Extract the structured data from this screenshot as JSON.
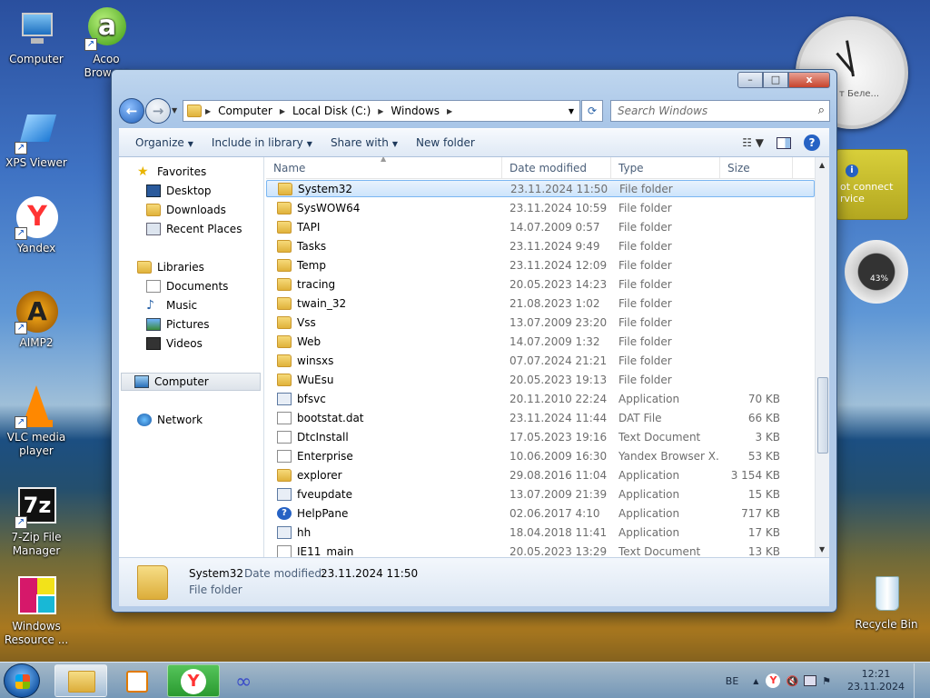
{
  "desktop": {
    "icons": [
      {
        "label": "Computer"
      },
      {
        "label": "Acoo Browser"
      },
      {
        "label": "XPS Viewer"
      },
      {
        "label": "Yandex"
      },
      {
        "label": "AIMP2"
      },
      {
        "label": "VLC media player"
      },
      {
        "label": "7-Zip File Manager"
      },
      {
        "label": "Windows Resource ..."
      },
      {
        "label": "Recycle Bin"
      }
    ],
    "gadget_text": "ot connect rvice",
    "gadget_clock_text": "т Беле...",
    "meter_value": "43%"
  },
  "window": {
    "controls": {
      "minimize": "–",
      "maximize": "□",
      "close": "x"
    },
    "address": [
      "Computer",
      "Local Disk (C:)",
      "Windows"
    ],
    "search_placeholder": "Search Windows",
    "toolbar": {
      "organize": "Organize",
      "include": "Include in library",
      "share": "Share with",
      "new_folder": "New folder"
    },
    "nav": {
      "favorites": "Favorites",
      "desktop": "Desktop",
      "downloads": "Downloads",
      "recent": "Recent Places",
      "libraries": "Libraries",
      "documents": "Documents",
      "music": "Music",
      "pictures": "Pictures",
      "videos": "Videos",
      "computer": "Computer",
      "network": "Network"
    },
    "columns": {
      "name": "Name",
      "date": "Date modified",
      "type": "Type",
      "size": "Size"
    },
    "files": [
      {
        "name": "System32",
        "date": "23.11.2024 11:50",
        "type": "File folder",
        "size": "",
        "icon": "folder"
      },
      {
        "name": "SysWOW64",
        "date": "23.11.2024 10:59",
        "type": "File folder",
        "size": "",
        "icon": "folder"
      },
      {
        "name": "TAPI",
        "date": "14.07.2009 0:57",
        "type": "File folder",
        "size": "",
        "icon": "folder"
      },
      {
        "name": "Tasks",
        "date": "23.11.2024 9:49",
        "type": "File folder",
        "size": "",
        "icon": "folder"
      },
      {
        "name": "Temp",
        "date": "23.11.2024 12:09",
        "type": "File folder",
        "size": "",
        "icon": "folder"
      },
      {
        "name": "tracing",
        "date": "20.05.2023 14:23",
        "type": "File folder",
        "size": "",
        "icon": "folder"
      },
      {
        "name": "twain_32",
        "date": "21.08.2023 1:02",
        "type": "File folder",
        "size": "",
        "icon": "folder"
      },
      {
        "name": "Vss",
        "date": "13.07.2009 23:20",
        "type": "File folder",
        "size": "",
        "icon": "folder"
      },
      {
        "name": "Web",
        "date": "14.07.2009 1:32",
        "type": "File folder",
        "size": "",
        "icon": "folder"
      },
      {
        "name": "winsxs",
        "date": "07.07.2024 21:21",
        "type": "File folder",
        "size": "",
        "icon": "folder"
      },
      {
        "name": "WuEsu",
        "date": "20.05.2023 19:13",
        "type": "File folder",
        "size": "",
        "icon": "folder"
      },
      {
        "name": "bfsvc",
        "date": "20.11.2010 22:24",
        "type": "Application",
        "size": "70 KB",
        "icon": "app"
      },
      {
        "name": "bootstat.dat",
        "date": "23.11.2024 11:44",
        "type": "DAT File",
        "size": "66 KB",
        "icon": "doc"
      },
      {
        "name": "DtcInstall",
        "date": "17.05.2023 19:16",
        "type": "Text Document",
        "size": "3 KB",
        "icon": "doc"
      },
      {
        "name": "Enterprise",
        "date": "10.06.2009 16:30",
        "type": "Yandex Browser X...",
        "size": "53 KB",
        "icon": "doc"
      },
      {
        "name": "explorer",
        "date": "29.08.2016 11:04",
        "type": "Application",
        "size": "3 154 KB",
        "icon": "folder"
      },
      {
        "name": "fveupdate",
        "date": "13.07.2009 21:39",
        "type": "Application",
        "size": "15 KB",
        "icon": "app"
      },
      {
        "name": "HelpPane",
        "date": "02.06.2017 4:10",
        "type": "Application",
        "size": "717 KB",
        "icon": "help"
      },
      {
        "name": "hh",
        "date": "18.04.2018 11:41",
        "type": "Application",
        "size": "17 KB",
        "icon": "app"
      },
      {
        "name": "IE11_main",
        "date": "20.05.2023 13:29",
        "type": "Text Document",
        "size": "13 KB",
        "icon": "doc"
      }
    ],
    "details": {
      "name": "System32",
      "modified_label": "Date modified:",
      "modified_value": "23.11.2024 11:50",
      "type": "File folder"
    }
  },
  "taskbar": {
    "language": "BE",
    "time": "12:21",
    "date": "23.11.2024"
  }
}
